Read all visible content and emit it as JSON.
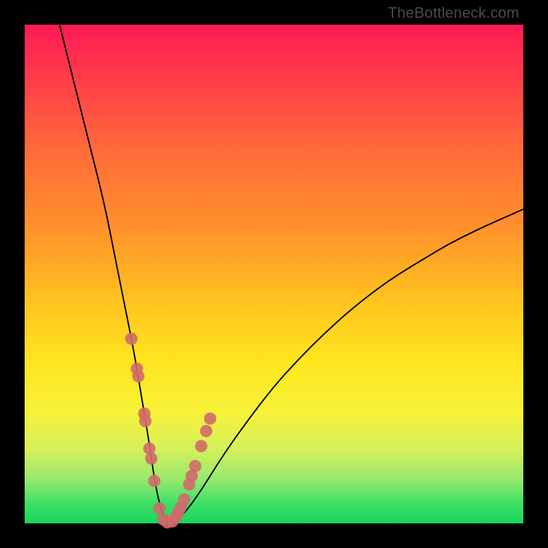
{
  "watermark": "TheBottleneck.com",
  "colors": {
    "frame": "#000000",
    "dot": "#d06a6a",
    "curve": "#000000",
    "gradient_stops": [
      {
        "pos": 0.0,
        "color": "#ff1a55"
      },
      {
        "pos": 0.1,
        "color": "#ff3a4a"
      },
      {
        "pos": 0.25,
        "color": "#ff6a3a"
      },
      {
        "pos": 0.4,
        "color": "#ff8f2c"
      },
      {
        "pos": 0.55,
        "color": "#ffc21f"
      },
      {
        "pos": 0.68,
        "color": "#ffe61f"
      },
      {
        "pos": 0.78,
        "color": "#f6f23a"
      },
      {
        "pos": 0.85,
        "color": "#d6f05a"
      },
      {
        "pos": 0.91,
        "color": "#9ae96e"
      },
      {
        "pos": 0.96,
        "color": "#3fdf66"
      },
      {
        "pos": 1.0,
        "color": "#18d65e"
      }
    ]
  },
  "chart_data": {
    "type": "line",
    "title": "",
    "xlabel": "",
    "ylabel": "",
    "xlim": [
      0,
      100
    ],
    "ylim": [
      0,
      100
    ],
    "series": [
      {
        "name": "bottleneck-curve",
        "x": [
          7,
          10,
          13,
          16,
          18,
          20,
          22,
          23.5,
          25,
          26,
          27,
          28,
          29,
          30,
          32,
          35,
          40,
          45,
          50,
          55,
          60,
          65,
          70,
          75,
          80,
          85,
          90,
          95,
          100
        ],
        "y": [
          100,
          88,
          76,
          64,
          54,
          44,
          34,
          25,
          16,
          9,
          4,
          1,
          0,
          0.3,
          2,
          6,
          14,
          21,
          27.5,
          33,
          38,
          42.5,
          46.5,
          50,
          53,
          56,
          58.5,
          60.8,
          63
        ],
        "note": "Values estimated from pixel positions; curve is a V-shape with minimum near x≈28.5, y≈0."
      }
    ],
    "points": {
      "name": "highlighted-dots",
      "note": "Cluster of salmon markers around the bottom of the V; x/y on same 0–100 scale as curve.",
      "x": [
        21.4,
        22.5,
        22.8,
        24.0,
        24.2,
        25.0,
        25.4,
        26.0,
        27.0,
        27.8,
        28.6,
        29.6,
        30.2,
        30.8,
        31.3,
        32.0,
        33.0,
        33.5,
        34.2,
        35.4,
        36.4,
        37.2
      ],
      "y": [
        37.0,
        31.0,
        29.5,
        22.0,
        20.5,
        15.0,
        13.0,
        8.5,
        3.0,
        0.8,
        0.2,
        0.4,
        1.2,
        2.2,
        3.2,
        4.8,
        7.8,
        9.5,
        11.5,
        15.5,
        18.5,
        21.0
      ]
    }
  }
}
